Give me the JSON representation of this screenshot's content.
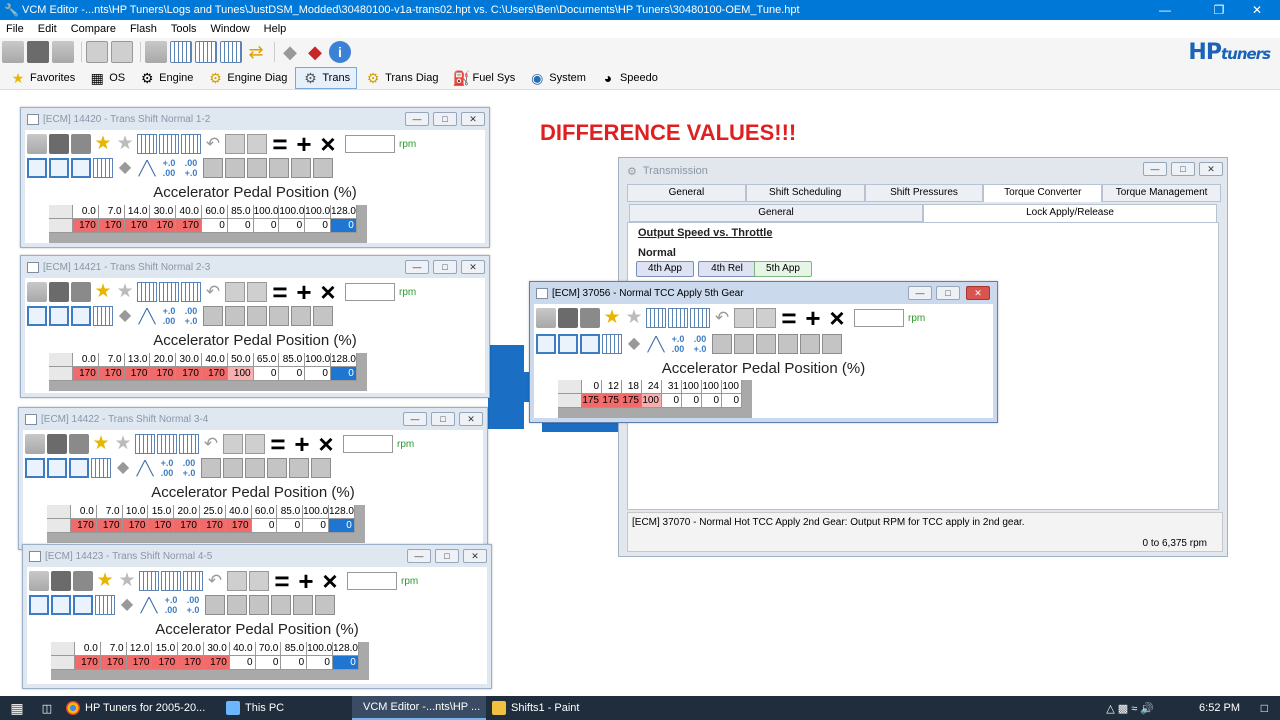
{
  "app": {
    "title": "VCM Editor -...nts\\HP Tuners\\Logs and Tunes\\JustDSM_Modded\\30480100-v1a-trans02.hpt vs. C:\\Users\\Ben\\Documents\\HP Tuners\\30480100-OEM_Tune.hpt"
  },
  "menu": [
    "File",
    "Edit",
    "Compare",
    "Flash",
    "Tools",
    "Window",
    "Help"
  ],
  "logo": {
    "main": "HP",
    "sub": "tuners"
  },
  "nav": [
    {
      "label": "Favorites",
      "icon": "star-icon",
      "selected": false
    },
    {
      "label": "OS",
      "icon": "chip-icon",
      "selected": false
    },
    {
      "label": "Engine",
      "icon": "engine-icon",
      "selected": false
    },
    {
      "label": "Engine Diag",
      "icon": "engine-diag-icon",
      "selected": false
    },
    {
      "label": "Trans",
      "icon": "gear-icon",
      "selected": true
    },
    {
      "label": "Trans Diag",
      "icon": "trans-diag-icon",
      "selected": false
    },
    {
      "label": "Fuel Sys",
      "icon": "fuel-pump-icon",
      "selected": false
    },
    {
      "label": "System",
      "icon": "system-icon",
      "selected": false
    },
    {
      "label": "Speedo",
      "icon": "speedometer-icon",
      "selected": false
    }
  ],
  "annotation": "DIFFERENCE VALUES!!!",
  "tables": [
    {
      "title": "[ECM] 14420 - Trans Shift Normal 1-2",
      "caption": "Accelerator Pedal Position (%)",
      "unit": "rpm",
      "headers": [
        "0.0",
        "7.0",
        "14.0",
        "30.0",
        "40.0",
        "60.0",
        "85.0",
        "100.0",
        "100.0",
        "100.0",
        "128.0"
      ],
      "values": [
        "170",
        "170",
        "170",
        "170",
        "170",
        "0",
        "0",
        "0",
        "0",
        "0",
        "0"
      ]
    },
    {
      "title": "[ECM] 14421 - Trans Shift Normal 2-3",
      "caption": "Accelerator Pedal Position (%)",
      "unit": "rpm",
      "headers": [
        "0.0",
        "7.0",
        "13.0",
        "20.0",
        "30.0",
        "40.0",
        "50.0",
        "65.0",
        "85.0",
        "100.0",
        "128.0"
      ],
      "values": [
        "170",
        "170",
        "170",
        "170",
        "170",
        "170",
        "100",
        "0",
        "0",
        "0",
        "0"
      ]
    },
    {
      "title": "[ECM] 14422 - Trans Shift Normal 3-4",
      "caption": "Accelerator Pedal Position (%)",
      "unit": "rpm",
      "headers": [
        "0.0",
        "7.0",
        "10.0",
        "15.0",
        "20.0",
        "25.0",
        "40.0",
        "60.0",
        "85.0",
        "100.0",
        "128.0"
      ],
      "values": [
        "170",
        "170",
        "170",
        "170",
        "170",
        "170",
        "170",
        "0",
        "0",
        "0",
        "0"
      ]
    },
    {
      "title": "[ECM] 14423 - Trans Shift Normal 4-5",
      "caption": "Accelerator Pedal Position (%)",
      "unit": "rpm",
      "headers": [
        "0.0",
        "7.0",
        "12.0",
        "15.0",
        "20.0",
        "30.0",
        "40.0",
        "70.0",
        "85.0",
        "100.0",
        "128.0"
      ],
      "values": [
        "170",
        "170",
        "170",
        "170",
        "170",
        "170",
        "0",
        "0",
        "0",
        "0",
        "0"
      ]
    }
  ],
  "tcc": {
    "title": "[ECM] 37056 - Normal TCC Apply 5th Gear",
    "caption": "Accelerator Pedal Position (%)",
    "unit": "rpm",
    "headers": [
      "0",
      "12",
      "18",
      "24",
      "31",
      "100",
      "100",
      "100"
    ],
    "values": [
      "175",
      "175",
      "175",
      "100",
      "0",
      "0",
      "0",
      "0"
    ]
  },
  "transmission": {
    "title": "Transmission",
    "tabs": [
      "General",
      "Shift Scheduling",
      "Shift Pressures",
      "Torque Converter",
      "Torque Management"
    ],
    "subtabs": [
      "General",
      "Lock Apply/Release"
    ],
    "section_title": "Output Speed vs. Throttle",
    "normal_label": "Normal",
    "buttons": [
      "4th App",
      "4th Rel",
      "5th App"
    ],
    "description": "[ECM] 37070 - Normal Hot TCC Apply 2nd Gear: Output RPM for TCC apply in 2nd gear.",
    "range": "0 to 6,375 rpm"
  },
  "taskbar": {
    "apps": [
      {
        "label": "HP Tuners for 2005-20...",
        "icon": "chrome-icon"
      },
      {
        "label": "This PC",
        "icon": "this-pc-icon"
      },
      {
        "label": "VCM Editor -...nts\\HP ...",
        "icon": "vcm-editor-icon"
      },
      {
        "label": "Shifts1 - Paint",
        "icon": "paint-icon"
      }
    ],
    "clock": "6:52 PM"
  }
}
